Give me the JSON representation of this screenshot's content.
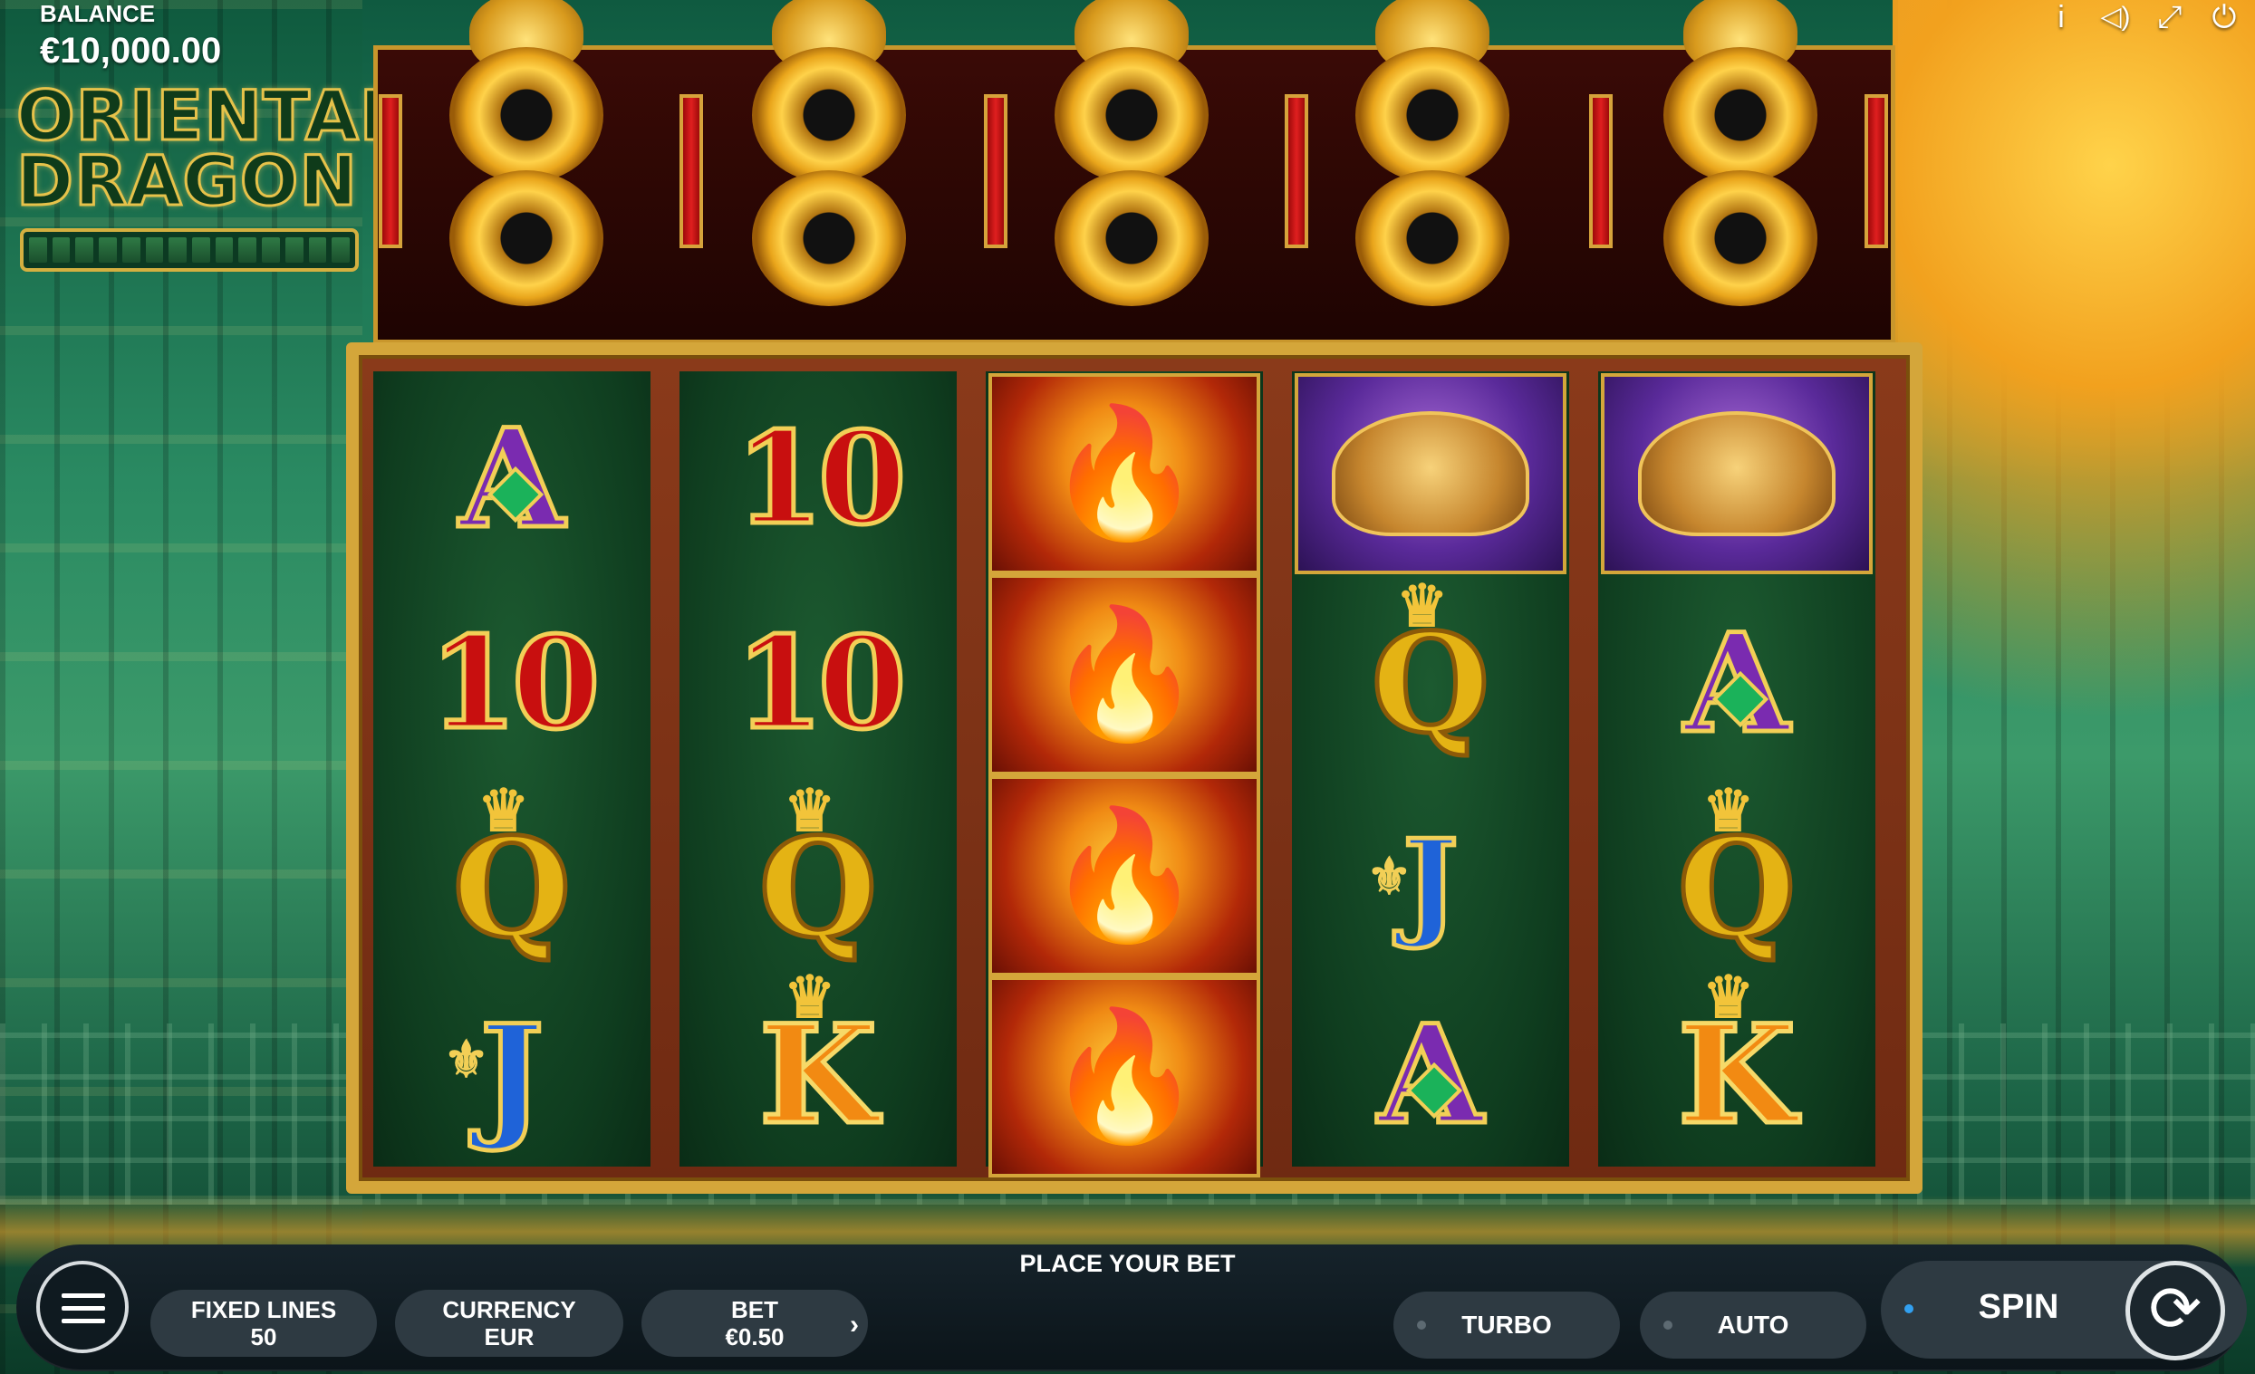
{
  "balance": {
    "label": "BALANCE",
    "value": "€10,000.00"
  },
  "logo": {
    "line1": "ORIENTAL",
    "line2": "DRAGON"
  },
  "top_icons": [
    "info-icon",
    "sound-icon",
    "fullscreen-icon",
    "power-icon"
  ],
  "top_icon_glyphs": {
    "info": "i",
    "sound": "◁)",
    "fullscreen": "⤢",
    "power": "⏻"
  },
  "reels": [
    [
      "A",
      "10",
      "Q",
      "J"
    ],
    [
      "10",
      "10",
      "Q",
      "K"
    ],
    [
      "phoenix",
      "phoenix",
      "phoenix",
      "phoenix"
    ],
    [
      "turtle",
      "Q",
      "J",
      "A"
    ],
    [
      "turtle",
      "A",
      "Q",
      "K"
    ]
  ],
  "symbols": {
    "A": "A",
    "ten": "10",
    "Q": "Q",
    "J": "J",
    "K": "K"
  },
  "message": "PLACE YOUR BET",
  "controls": {
    "fixed_lines_label": "FIXED LINES",
    "fixed_lines_value": "50",
    "currency_label": "CURRENCY",
    "currency_value": "EUR",
    "bet_label": "BET",
    "bet_value": "€0.50",
    "bet_chevron": "›",
    "turbo_label": "TURBO",
    "auto_label": "AUTO",
    "spin_label": "SPIN",
    "spin_icon": "⟳"
  },
  "colors": {
    "accent_gold": "#d4a63a",
    "bar": "#2e3a42",
    "spin_indicator": "#32a0f0"
  }
}
